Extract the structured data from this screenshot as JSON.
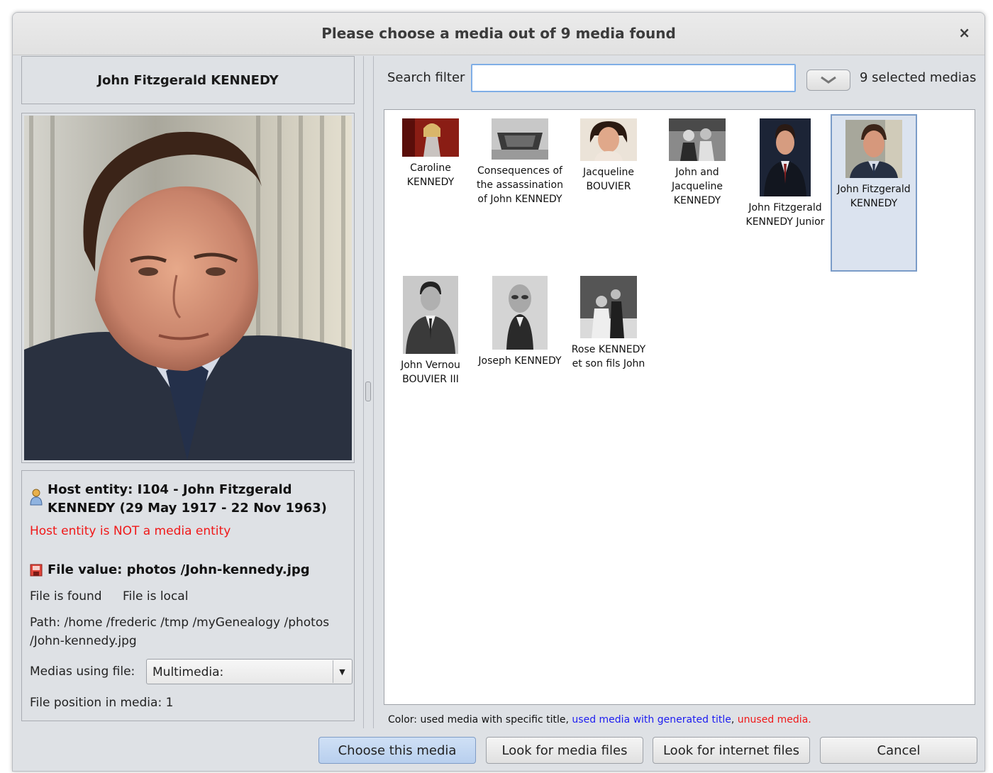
{
  "dialog": {
    "title": "Please choose a media out of 9 media found",
    "close_glyph": "×"
  },
  "left": {
    "entity_name": "John Fitzgerald KENNEDY",
    "host_entity": "Host entity: I104 - John Fitzgerald KENNEDY (29 May 1917 - 22 Nov 1963)",
    "host_warning": "Host entity is NOT a media entity",
    "file_value": "File value: photos /John-kennedy.jpg",
    "file_found": "File is found",
    "file_local": "File is local",
    "path": "Path: /home /frederic /tmp /myGenealogy /photos /John-kennedy.jpg",
    "medias_using_label": "Medias using file:",
    "medias_using_value": "Multimedia:",
    "file_position": "File position in media: 1"
  },
  "right": {
    "search_label": "Search filter",
    "search_value": "",
    "selected_count": "9 selected medias",
    "thumbnails": [
      {
        "label": "Caroline KENNEDY",
        "icon": "portrait-color-woman"
      },
      {
        "label": "Consequences of the assassination of John KENNEDY",
        "icon": "memorial-plaque"
      },
      {
        "label": "Jacqueline BOUVIER",
        "icon": "portrait-color-woman"
      },
      {
        "label": "John and Jacqueline KENNEDY",
        "icon": "bw-photo-couple"
      },
      {
        "label": "John Fitzgerald KENNEDY Junior",
        "icon": "portrait-man-suit"
      },
      {
        "label": "John Fitzgerald KENNEDY",
        "icon": "portrait-man-suit",
        "selected": true
      },
      {
        "label": "John Vernou BOUVIER III",
        "icon": "bw-portrait-man"
      },
      {
        "label": "Joseph KENNEDY",
        "icon": "bw-portrait-man"
      },
      {
        "label": "Rose KENNEDY et son fils John",
        "icon": "bw-photo-group"
      }
    ],
    "legend": {
      "prefix": "Color: used media with specific title, ",
      "blue": "used media with generated title",
      "sep": ", ",
      "red": "unused media."
    },
    "colors": {
      "generated": "#1c1cf0",
      "unused": "#f01818"
    }
  },
  "buttons": {
    "choose": "Choose this media",
    "look_files": "Look for media files",
    "look_internet": "Look for internet files",
    "cancel": "Cancel"
  }
}
